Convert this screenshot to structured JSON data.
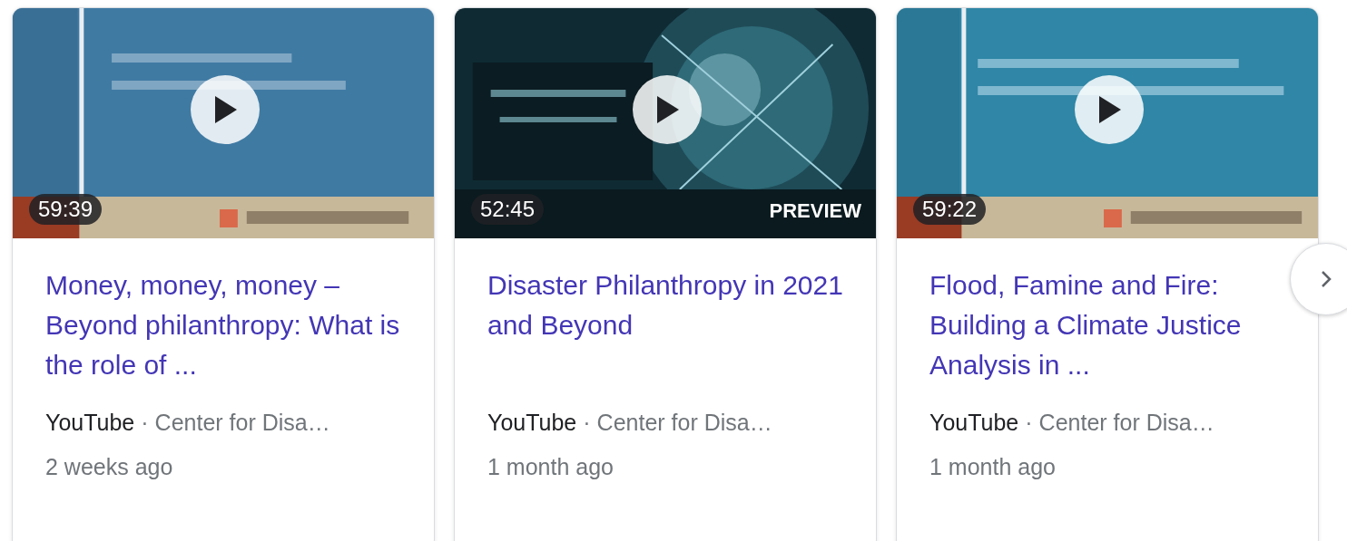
{
  "videos": [
    {
      "duration": "59:39",
      "title": "Money, money, money – Beyond philanthropy: What is the role of ...",
      "source": "YouTube",
      "separator": "·",
      "channel": "Center for Disa…",
      "age": "2 weeks ago"
    },
    {
      "duration": "52:45",
      "badge": "PREVIEW",
      "title": "Disaster Philanthropy in 2021 and Beyond",
      "source": "YouTube",
      "separator": "·",
      "channel": "Center for Disa…",
      "age": "1 month ago"
    },
    {
      "duration": "59:22",
      "title": "Flood, Famine and Fire: Building a Climate Justice Analysis in ...",
      "source": "YouTube",
      "separator": "·",
      "channel": "Center for Disa…",
      "age": "1 month ago"
    }
  ]
}
